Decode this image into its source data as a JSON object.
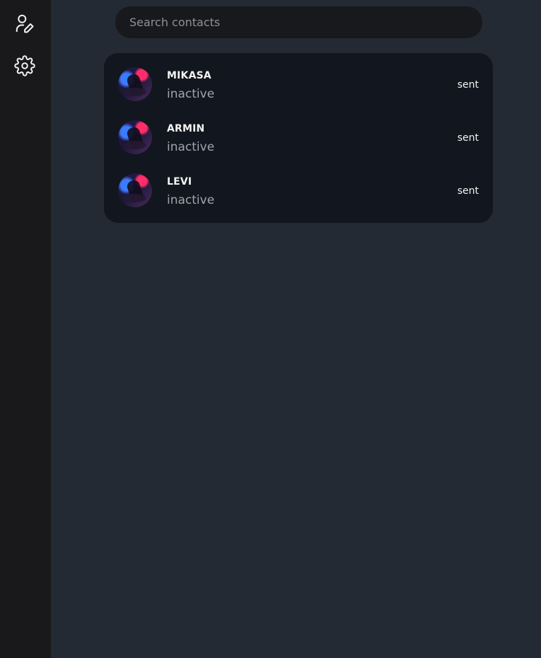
{
  "sidebar": {
    "items": [
      {
        "icon": "user-edit-icon"
      },
      {
        "icon": "gear-icon"
      }
    ],
    "icon_color": "#f2f2f2",
    "background": "#19191b"
  },
  "search": {
    "placeholder": "Search contacts",
    "value": ""
  },
  "contacts": [
    {
      "name": "MIKASA",
      "status": "inactive",
      "last_message": "sent"
    },
    {
      "name": "ARMIN",
      "status": "inactive",
      "last_message": "sent"
    },
    {
      "name": "LEVI",
      "status": "inactive",
      "last_message": "sent"
    }
  ],
  "colors": {
    "main_background": "#232a33",
    "card_background": "#12161e",
    "search_background": "#18191c"
  }
}
